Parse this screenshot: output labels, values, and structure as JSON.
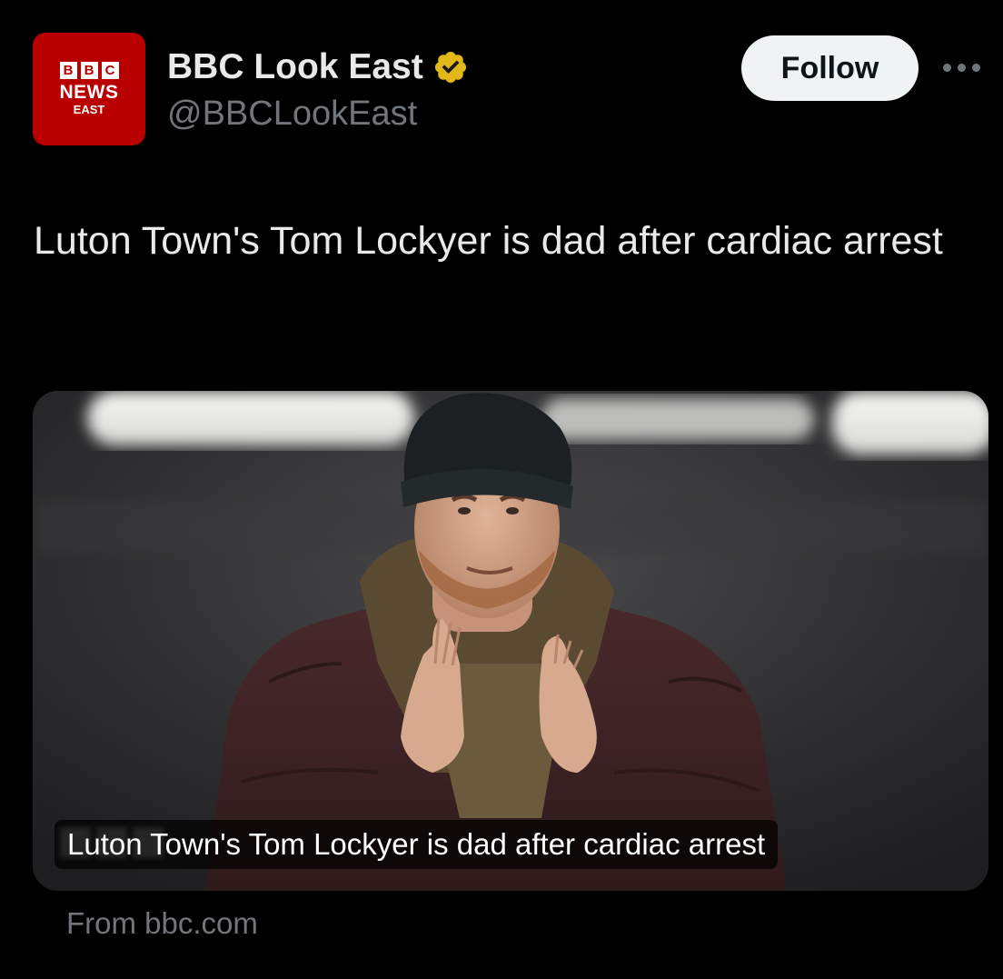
{
  "author": {
    "avatar": {
      "brand_letters": [
        "B",
        "B",
        "C"
      ],
      "brand_word": "NEWS",
      "region": "EAST",
      "background_color": "#b80000"
    },
    "display_name": "BBC Look East",
    "verified_badge": "gold-verified-icon",
    "handle": "@BBCLookEast"
  },
  "actions": {
    "follow_label": "Follow",
    "more_icon": "more-horizontal-icon"
  },
  "tweet": {
    "text": "Luton Town's Tom Lockyer is dad after cardiac arrest"
  },
  "card": {
    "image_subject": "photo",
    "title": "Luton Town's Tom Lockyer is dad after cardiac arrest",
    "source": "From bbc.com"
  },
  "colors": {
    "background": "#000000",
    "primary_text": "#e7e9ea",
    "secondary_text": "#71767b",
    "follow_button_bg": "#eff3f4",
    "verified_gold": "#e2b719"
  }
}
